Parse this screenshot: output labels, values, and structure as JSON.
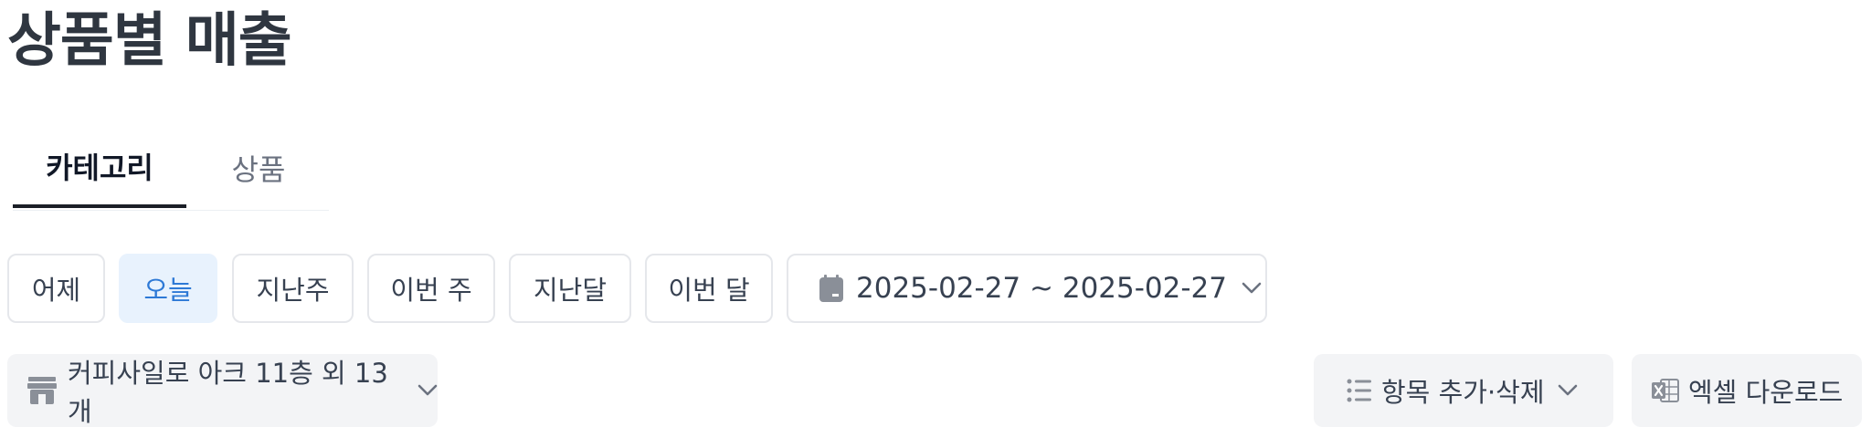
{
  "page": {
    "title": "상품별 매출"
  },
  "tabs": [
    {
      "label": "카테고리",
      "active": true
    },
    {
      "label": "상품",
      "active": false
    }
  ],
  "quick_ranges": [
    {
      "label": "어제",
      "selected": false
    },
    {
      "label": "오늘",
      "selected": true
    },
    {
      "label": "지난주",
      "selected": false
    },
    {
      "label": "이번 주",
      "selected": false
    },
    {
      "label": "지난달",
      "selected": false
    },
    {
      "label": "이번 달",
      "selected": false
    }
  ],
  "date_range": {
    "value": "2025-02-27 ~ 2025-02-27",
    "icon": "calendar-icon"
  },
  "store_filter": {
    "label": "커피사일로 아크 11층 외 13개",
    "icon": "store-icon"
  },
  "column_toggle": {
    "label": "항목 추가·삭제",
    "icon": "list-icon"
  },
  "excel_download": {
    "label": "엑셀 다운로드",
    "icon": "excel-icon"
  },
  "colors": {
    "accent": "#2d79d6",
    "accent_bg": "#e8f2fd",
    "icon_gray": "#8a8f98",
    "button_bg": "#f3f4f6"
  }
}
